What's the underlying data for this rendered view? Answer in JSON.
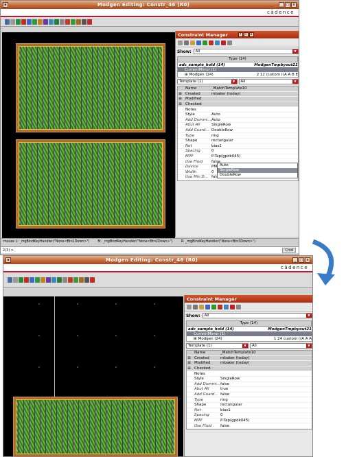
{
  "window1": {
    "title": "Modgen Editing: Constr_46 (R0)",
    "brand": "cādence",
    "constraint_manager": {
      "title": "Constraint Manager",
      "show_label": "Show:",
      "show_value": "All",
      "tree_header": "Type (14)",
      "tree_rows": [
        {
          "name": "adc_sample_hold (14)",
          "value": "ModgenTmpbyout21"
        },
        {
          "name": "CurrentMirror (1)",
          "value": ""
        },
        {
          "name": "Modgen (24)",
          "value": "2 12 custom ((A A B E"
        }
      ],
      "template_label": "Template (1)",
      "template_value": "All",
      "properties": [
        {
          "key": "Name",
          "value": "_MatchTemplate10"
        },
        {
          "key": "Created",
          "value": "mbaker (today)"
        },
        {
          "key": "Modified",
          "value": ""
        },
        {
          "key": "Checked",
          "value": ""
        },
        {
          "key": "Notes",
          "value": ""
        },
        {
          "key": "Style",
          "value": "Auto"
        },
        {
          "key": "Add Dummi...",
          "value": "Auto"
        },
        {
          "key": "Abut All",
          "value": "SingleRow"
        },
        {
          "key": "Add Guard...",
          "value": "DoubleRow"
        },
        {
          "key": "Type",
          "value": "ring"
        },
        {
          "key": "Shape",
          "value": "rectangular"
        },
        {
          "key": "Net",
          "value": "bias1"
        },
        {
          "key": "Spacing",
          "value": "0"
        },
        {
          "key": "MPP",
          "value": "P-Tap(gpdk045)"
        },
        {
          "key": "Use Fluid",
          "value": "false"
        },
        {
          "key": "Device",
          "value": "PM6"
        },
        {
          "key": "Width",
          "value": "0"
        },
        {
          "key": "Use Min D...",
          "value": "false"
        }
      ]
    },
    "status_bar": {
      "left": "mouse L: _mgBindKeyHandler(\"None<Btn1Down>\")",
      "mid": "M: _mgBindKeyHandler(\"None<Btn2Down>\")",
      "right": "R: _mgBindKeyHandler(\"None<Btn3Down>\")"
    },
    "cmd_prompt": "2(3) >",
    "cmd_button": "Cmd"
  },
  "window2": {
    "title": "Modgen Editing: Constr_46 (R0)",
    "brand": "cādence",
    "constraint_manager": {
      "title": "Constraint Manager",
      "show_label": "Show:",
      "show_value": "All",
      "tree_header": "Type (14)",
      "tree_rows": [
        {
          "name": "adc_sample_hold (14)",
          "value": "ModgenTmpbyout21"
        },
        {
          "name": "CurrentMirror (1)",
          "value": ""
        },
        {
          "name": "Modgen (24)",
          "value": "1 24 custom ((A A A"
        }
      ],
      "template_label": "Template (1)",
      "template_value": "All",
      "properties": [
        {
          "key": "Name",
          "value": "_MatchTemplate10"
        },
        {
          "key": "Created",
          "value": "mbaker (today)"
        },
        {
          "key": "Modified",
          "value": "mbaker (today)"
        },
        {
          "key": "Checked",
          "value": ""
        },
        {
          "key": "Notes",
          "value": ""
        },
        {
          "key": "Style",
          "value": "SingleRow"
        },
        {
          "key": "Add Dummi...",
          "value": "false"
        },
        {
          "key": "Abut All",
          "value": "true"
        },
        {
          "key": "Add Guard...",
          "value": "false"
        },
        {
          "key": "Type",
          "value": "ring"
        },
        {
          "key": "Shape",
          "value": "rectangular"
        },
        {
          "key": "Net",
          "value": "bias1"
        },
        {
          "key": "Spacing",
          "value": "0"
        },
        {
          "key": "MPP",
          "value": "P-Tap(gpdk045)"
        },
        {
          "key": "Use Fluid",
          "value": "false"
        }
      ]
    }
  },
  "colors": {
    "accent": "#c0162b",
    "arrow": "#3a7bc8"
  }
}
